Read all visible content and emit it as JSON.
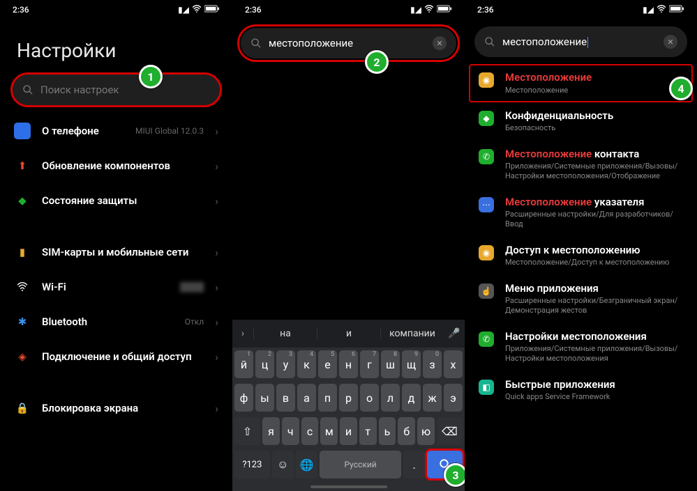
{
  "status": {
    "time": "2:36"
  },
  "panel1": {
    "title": "Настройки",
    "search_placeholder": "Поиск настроек",
    "items": [
      {
        "label": "О телефоне",
        "right": "MIUI Global 12.0.3",
        "icon_bg": "#2d6fe8"
      },
      {
        "label": "Обновление компонентов",
        "icon_bg": "#e84b2d"
      },
      {
        "label": "Состояние защиты",
        "icon_bg": "#1fae2d"
      }
    ],
    "items2": [
      {
        "label": "SIM-карты и мобильные сети",
        "icon_bg": "#e8a82d"
      },
      {
        "label": "Wi-Fi",
        "right": "",
        "icon_bg": "#000"
      },
      {
        "label": "Bluetooth",
        "right": "Откл",
        "icon_bg": "#000"
      },
      {
        "label": "Подключение и общий доступ",
        "icon_bg": "#e84b2d"
      }
    ],
    "items3": [
      {
        "label": "Блокировка экрана",
        "icon_bg": "#e84b2d"
      }
    ]
  },
  "panel2": {
    "search_value": "местоположение",
    "suggestions": [
      "на",
      "и",
      "компании"
    ],
    "keyboard": {
      "row1": [
        "й",
        "ц",
        "у",
        "к",
        "е",
        "н",
        "г",
        "ш",
        "щ",
        "з",
        "х"
      ],
      "row1sup": [
        "1",
        "2",
        "3",
        "4",
        "5",
        "6",
        "7",
        "8",
        "9",
        "0",
        ""
      ],
      "row2": [
        "ф",
        "ы",
        "в",
        "а",
        "п",
        "р",
        "о",
        "л",
        "д",
        "ж",
        "э"
      ],
      "row3": [
        "я",
        "ч",
        "с",
        "м",
        "и",
        "т",
        "ь",
        "б",
        "ю"
      ],
      "lang": "Русский",
      "numkey": "?123"
    }
  },
  "panel3": {
    "search_value": "местоположение",
    "results": [
      {
        "title_hl": "Местоположение",
        "title_rest": "",
        "sub": "Местоположение",
        "icon_bg": "#e8a82d"
      },
      {
        "title_hl": "",
        "title_rest": "Конфиденциальность",
        "sub": "Безопасность",
        "icon_bg": "#1fae2d"
      },
      {
        "title_hl": "Местоположение",
        "title_rest": " контакта",
        "sub": "Приложения/Системные приложения/Вызовы/Настройки местоположения/Отображение",
        "icon_bg": "#1fae2d"
      },
      {
        "title_hl": "Местоположение",
        "title_rest": " указателя",
        "sub": "Расширенные настройки/Для разработчиков/Ввод",
        "icon_bg": "#3a6fe0"
      },
      {
        "title_hl": "",
        "title_rest": "Доступ к местоположению",
        "sub": "Местоположение/Доступ к местоположению",
        "icon_bg": "#e8a82d"
      },
      {
        "title_hl": "",
        "title_rest": "Меню приложения",
        "sub": "Расширенные настройки/Безграничный экран/Демонстрация жестов",
        "icon_bg": "#555"
      },
      {
        "title_hl": "",
        "title_rest": "Настройки местоположения",
        "sub": "Приложения/Системные приложения/Вызовы/Настройки местоположения",
        "icon_bg": "#1fae2d"
      },
      {
        "title_hl": "",
        "title_rest": "Быстрые приложения",
        "sub": "Quick apps Service Framework",
        "icon_bg": "#17b58f"
      }
    ]
  },
  "badges": {
    "b1": "1",
    "b2": "2",
    "b3": "3",
    "b4": "4"
  }
}
